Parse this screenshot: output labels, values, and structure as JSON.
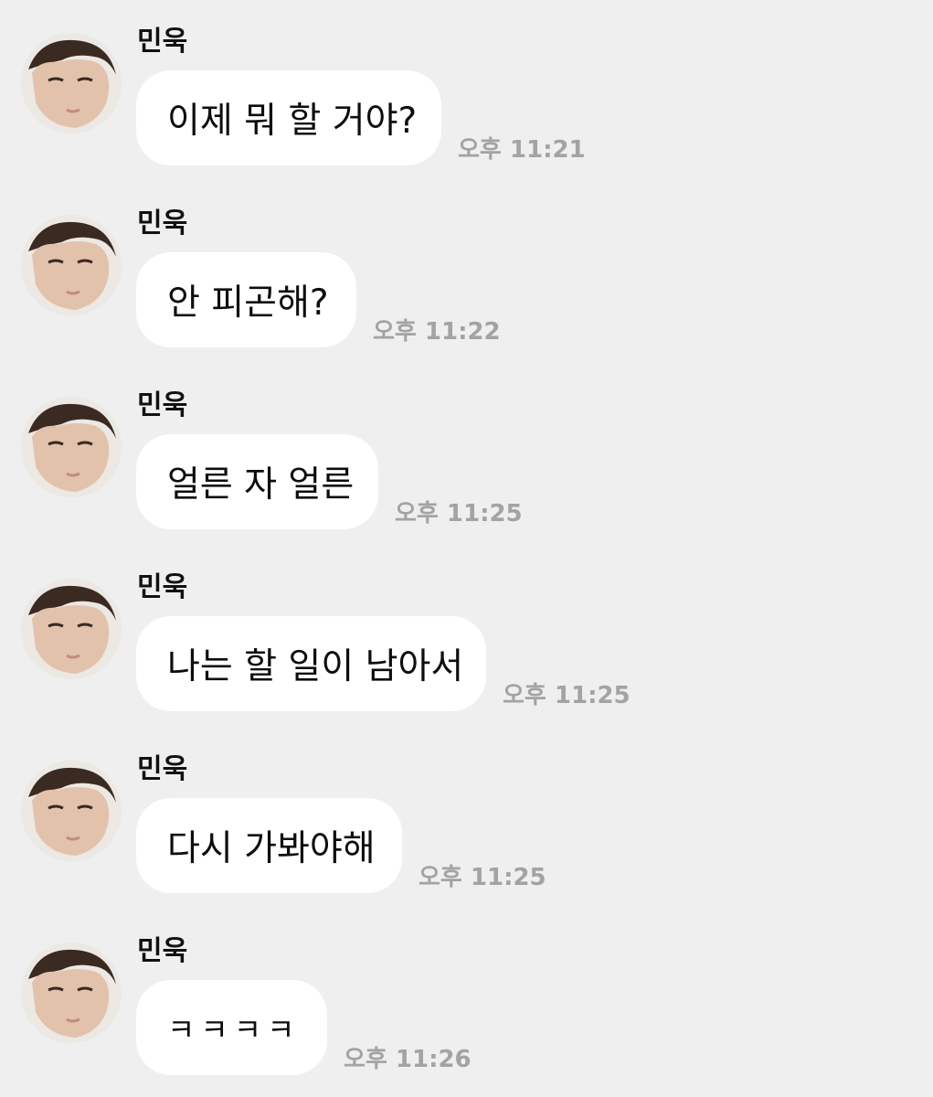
{
  "chat": {
    "messages": [
      {
        "sender": "민욱",
        "avatar_icon": "profile-photo",
        "text": "이제 뭐 할 거야?",
        "time": "오후 11:21"
      },
      {
        "sender": "민욱",
        "avatar_icon": "profile-photo",
        "text": "안 피곤해?",
        "time": "오후 11:22"
      },
      {
        "sender": "민욱",
        "avatar_icon": "profile-photo",
        "text": "얼른 자 얼른",
        "time": "오후 11:25"
      },
      {
        "sender": "민욱",
        "avatar_icon": "profile-photo",
        "text": "나는 할 일이 남아서",
        "time": "오후 11:25"
      },
      {
        "sender": "민욱",
        "avatar_icon": "profile-photo",
        "text": "다시 가봐야해",
        "time": "오후 11:25"
      },
      {
        "sender": "민욱",
        "avatar_icon": "profile-photo",
        "text": "ㅋㅋㅋㅋ",
        "time": "오후 11:26"
      }
    ]
  },
  "colors": {
    "background": "#efefef",
    "bubble": "#ffffff",
    "text": "#0d0d0d",
    "timestamp": "#a3a3a3"
  }
}
